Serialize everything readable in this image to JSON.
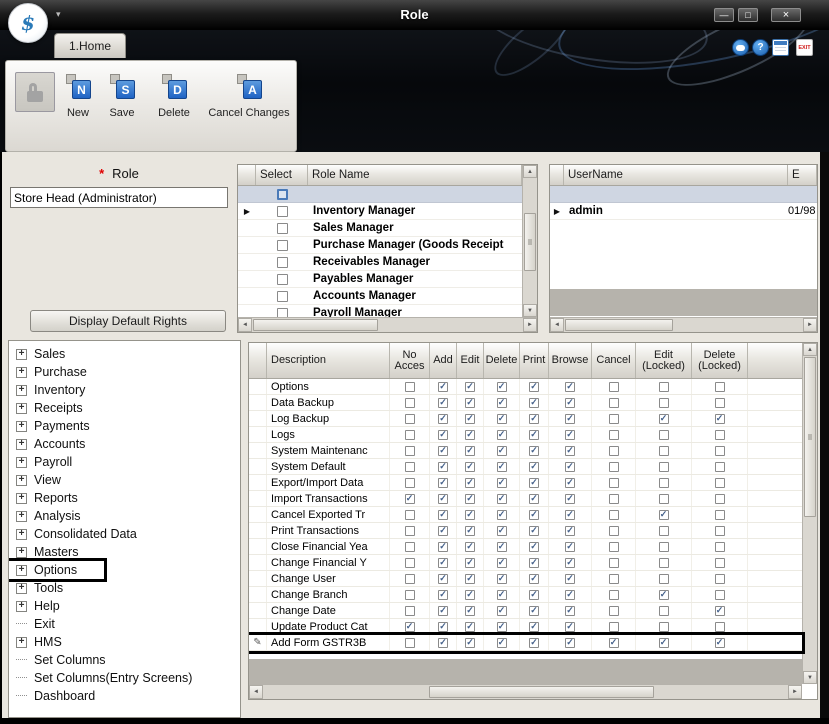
{
  "window": {
    "title": "Role",
    "tab": "1.Home"
  },
  "icons": {
    "logo": "$",
    "caret_down": "▾",
    "minimize": "—",
    "maximize": "□",
    "close": "×",
    "help": "?",
    "exit_label": "EXIT",
    "row_indicator": "▶",
    "edit_pencil": "✎",
    "check": "✓",
    "scroll_up": "▲",
    "scroll_down": "▼",
    "scroll_left": "◄",
    "scroll_right": "►",
    "expand": "+"
  },
  "colors": {
    "accent_blue": "#1f63c4",
    "check_blue": "#44608a",
    "required_red": "#e00000",
    "highlight_border": "#000000"
  },
  "ribbon": {
    "buttons": [
      {
        "label": "New",
        "glyph": "N"
      },
      {
        "label": "Save",
        "glyph": "S"
      },
      {
        "label": "Delete",
        "glyph": "D"
      },
      {
        "label": "Cancel Changes",
        "glyph": "A"
      }
    ]
  },
  "role_panel": {
    "required_mark": "*",
    "label": "Role",
    "value": "Store Head (Administrator)",
    "button": "Display Default Rights"
  },
  "roles_grid": {
    "columns": [
      "Select",
      "Role Name"
    ],
    "rows": [
      "Inventory Manager",
      "Sales Manager",
      "Purchase Manager (Goods Receipt",
      "Receivables Manager",
      "Payables Manager",
      "Accounts Manager",
      "Payroll Manager"
    ]
  },
  "users_grid": {
    "columns": [
      "UserName",
      "E"
    ],
    "rows": [
      {
        "username": "admin",
        "extra": "01/98"
      }
    ]
  },
  "tree": {
    "items": [
      {
        "label": "Sales",
        "leaf": false
      },
      {
        "label": "Purchase",
        "leaf": false
      },
      {
        "label": "Inventory",
        "leaf": false
      },
      {
        "label": "Receipts",
        "leaf": false
      },
      {
        "label": "Payments",
        "leaf": false
      },
      {
        "label": "Accounts",
        "leaf": false
      },
      {
        "label": "Payroll",
        "leaf": false
      },
      {
        "label": "View",
        "leaf": false
      },
      {
        "label": "Reports",
        "leaf": false
      },
      {
        "label": "Analysis",
        "leaf": false
      },
      {
        "label": "Consolidated Data",
        "leaf": false
      },
      {
        "label": "Masters",
        "leaf": false
      },
      {
        "label": "Options",
        "leaf": false,
        "highlighted": true
      },
      {
        "label": "Tools",
        "leaf": false
      },
      {
        "label": "Help",
        "leaf": false
      },
      {
        "label": "Exit",
        "leaf": true
      },
      {
        "label": "HMS",
        "leaf": false
      },
      {
        "label": "Set Columns",
        "leaf": true
      },
      {
        "label": "Set Columns(Entry Screens)",
        "leaf": true
      },
      {
        "label": "Dashboard",
        "leaf": true
      }
    ]
  },
  "rights_grid": {
    "columns": [
      "Description",
      "No\nAcces",
      "Add",
      "Edit",
      "Delete",
      "Print",
      "Browse",
      "Cancel",
      "Edit\n(Locked)",
      "Delete\n(Locked)"
    ],
    "rows": [
      {
        "description": "Options",
        "checks": [
          false,
          true,
          true,
          true,
          true,
          true,
          false,
          false,
          false
        ]
      },
      {
        "description": "Data Backup",
        "checks": [
          false,
          true,
          true,
          true,
          true,
          true,
          false,
          false,
          false
        ]
      },
      {
        "description": "Log Backup",
        "checks": [
          false,
          true,
          true,
          true,
          true,
          true,
          false,
          true,
          true
        ]
      },
      {
        "description": "Logs",
        "checks": [
          false,
          true,
          true,
          true,
          true,
          true,
          false,
          false,
          false
        ]
      },
      {
        "description": "System Maintenanc",
        "checks": [
          false,
          true,
          true,
          true,
          true,
          true,
          false,
          false,
          false
        ]
      },
      {
        "description": "System Default",
        "checks": [
          false,
          true,
          true,
          true,
          true,
          true,
          false,
          false,
          false
        ]
      },
      {
        "description": "Export/Import Data",
        "checks": [
          false,
          true,
          true,
          true,
          true,
          true,
          false,
          false,
          false
        ]
      },
      {
        "description": "Import Transactions",
        "checks": [
          true,
          true,
          true,
          true,
          true,
          true,
          false,
          false,
          false
        ]
      },
      {
        "description": "Cancel  Exported Tr",
        "checks": [
          false,
          true,
          true,
          true,
          true,
          true,
          false,
          true,
          false
        ]
      },
      {
        "description": "Print Transactions",
        "checks": [
          false,
          true,
          true,
          true,
          true,
          true,
          false,
          false,
          false
        ]
      },
      {
        "description": "Close  Financial Yea",
        "checks": [
          false,
          true,
          true,
          true,
          true,
          true,
          false,
          false,
          false
        ]
      },
      {
        "description": "Change  Financial Y",
        "checks": [
          false,
          true,
          true,
          true,
          true,
          true,
          false,
          false,
          false
        ]
      },
      {
        "description": "Change User",
        "checks": [
          false,
          true,
          true,
          true,
          true,
          true,
          false,
          false,
          false
        ]
      },
      {
        "description": "Change Branch",
        "checks": [
          false,
          true,
          true,
          true,
          true,
          true,
          false,
          true,
          false
        ]
      },
      {
        "description": "Change Date",
        "checks": [
          false,
          true,
          true,
          true,
          true,
          true,
          false,
          false,
          true
        ]
      },
      {
        "description": "Update  Product Cat",
        "checks": [
          true,
          true,
          true,
          true,
          true,
          true,
          false,
          false,
          false
        ]
      },
      {
        "description": "Add Form GSTR3B",
        "checks": [
          false,
          true,
          true,
          true,
          true,
          true,
          true,
          true,
          true
        ],
        "highlighted": true,
        "editing": true
      }
    ]
  }
}
